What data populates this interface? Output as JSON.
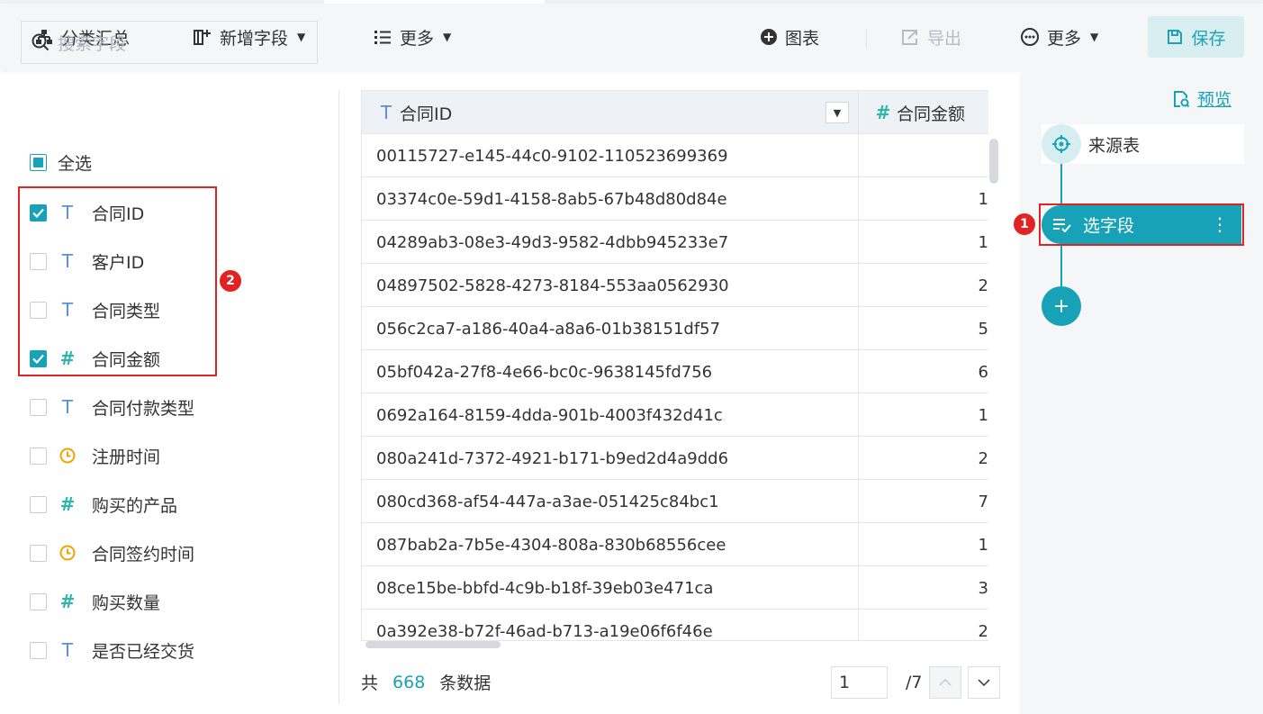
{
  "toolbar": {
    "group_summary": "分类汇总",
    "add_field": "新增字段",
    "more_left": "更多",
    "chart": "图表",
    "export": "导出",
    "more_right": "更多",
    "save": "保存"
  },
  "left_panel": {
    "search_placeholder": "搜索字段",
    "select_all": "全选",
    "fields": [
      {
        "label": "合同ID",
        "type": "text",
        "checked": true
      },
      {
        "label": "客户ID",
        "type": "text",
        "checked": false
      },
      {
        "label": "合同类型",
        "type": "text",
        "checked": false
      },
      {
        "label": "合同金额",
        "type": "number",
        "checked": true
      },
      {
        "label": "合同付款类型",
        "type": "text",
        "checked": false
      },
      {
        "label": "注册时间",
        "type": "date",
        "checked": false
      },
      {
        "label": "购买的产品",
        "type": "number",
        "checked": false
      },
      {
        "label": "合同签约时间",
        "type": "date",
        "checked": false
      },
      {
        "label": "购买数量",
        "type": "number",
        "checked": false
      },
      {
        "label": "是否已经交货",
        "type": "text",
        "checked": false
      }
    ],
    "badge": "2"
  },
  "table": {
    "columns": [
      "合同ID",
      "合同金额"
    ],
    "rows": [
      [
        "00115727-e145-44c0-9102-110523699369",
        ""
      ],
      [
        "03374c0e-59d1-4158-8ab5-67b48d80d84e",
        "1"
      ],
      [
        "04289ab3-08e3-49d3-9582-4dbb945233e7",
        "1"
      ],
      [
        "04897502-5828-4273-8184-553aa0562930",
        "2"
      ],
      [
        "056c2ca7-a186-40a4-a8a6-01b38151df57",
        "5"
      ],
      [
        "05bf042a-27f8-4e66-bc0c-9638145fd756",
        "6"
      ],
      [
        "0692a164-8159-4dda-901b-4003f432d41c",
        "1"
      ],
      [
        "080a241d-7372-4921-b171-b9ed2d4a9dd6",
        "2"
      ],
      [
        "080cd368-af54-447a-a3ae-051425c84bc1",
        "7"
      ],
      [
        "087bab2a-7b5e-4304-808a-830b68556cee",
        "1"
      ],
      [
        "08ce15be-bbfd-4c9b-b18f-39eb03e471ca",
        "3"
      ],
      [
        "0a392e38-b72f-46ad-b713-a19e06f6f46e",
        "2"
      ]
    ]
  },
  "footer": {
    "prefix": "共",
    "count": "668",
    "suffix": "条数据",
    "page": "1",
    "total_pages": "/7"
  },
  "right_panel": {
    "preview": "预览",
    "source_node": "来源表",
    "select_node": "选字段",
    "badge": "1"
  },
  "colors": {
    "accent": "#17a2b8",
    "highlight": "#e02424"
  }
}
